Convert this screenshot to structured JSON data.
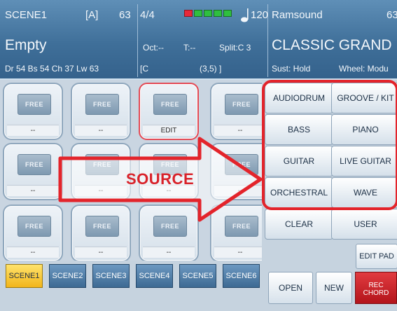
{
  "header": {
    "scene_name": "SCENE1",
    "scene_group": "[A]",
    "scene_number": "63",
    "style_name": "Empty",
    "style_info": "Dr 54   Bs 54   Ch 37   Lw 63",
    "time_signature": "4/4",
    "tempo": "120",
    "octave": "Oct:--",
    "transpose": "T:--",
    "split": "Split:C 3",
    "chord": "[C",
    "chord_pos": "(3,5) ]",
    "sound_bank": "Ramsound",
    "sound_number": "63",
    "sound_name": "CLASSIC GRAND",
    "sustain": "Sust: Hold",
    "wheel": "Wheel: Modu",
    "meter_segments": [
      "red",
      "green",
      "green",
      "green",
      "green"
    ]
  },
  "pads": [
    {
      "thumb": "FREE",
      "label": "--"
    },
    {
      "thumb": "FREE",
      "label": "--"
    },
    {
      "thumb": "FREE",
      "label": "EDIT"
    },
    {
      "thumb": "FREE",
      "label": "--"
    },
    {
      "thumb": "FREE",
      "label": "--"
    },
    {
      "thumb": "FREE",
      "label": "--"
    },
    {
      "thumb": "FREE",
      "label": "--"
    },
    {
      "thumb": "FREE",
      "label": "--"
    },
    {
      "thumb": "FREE",
      "label": "--"
    },
    {
      "thumb": "FREE",
      "label": "--"
    },
    {
      "thumb": "FREE",
      "label": "--"
    },
    {
      "thumb": "FREE",
      "label": "--"
    }
  ],
  "source_buttons": [
    "AUDIODRUM",
    "GROOVE / KIT",
    "BASS",
    "PIANO",
    "GUITAR",
    "LIVE GUITAR",
    "ORCHESTRAL",
    "WAVE",
    "CLEAR",
    "USER"
  ],
  "annotation": "SOURCE",
  "edit_pad": "EDIT PAD",
  "scenes": [
    "SCENE1",
    "SCENE2",
    "SCENE3",
    "SCENE4",
    "SCENE5",
    "SCENE6"
  ],
  "bottom_buttons": {
    "open": "OPEN",
    "new": "NEW",
    "rec_line1": "REC",
    "rec_line2": "CHORD"
  },
  "colors": {
    "header": "#3f6f99",
    "highlight": "#e3242b",
    "scene_active": "#f2b51a"
  }
}
